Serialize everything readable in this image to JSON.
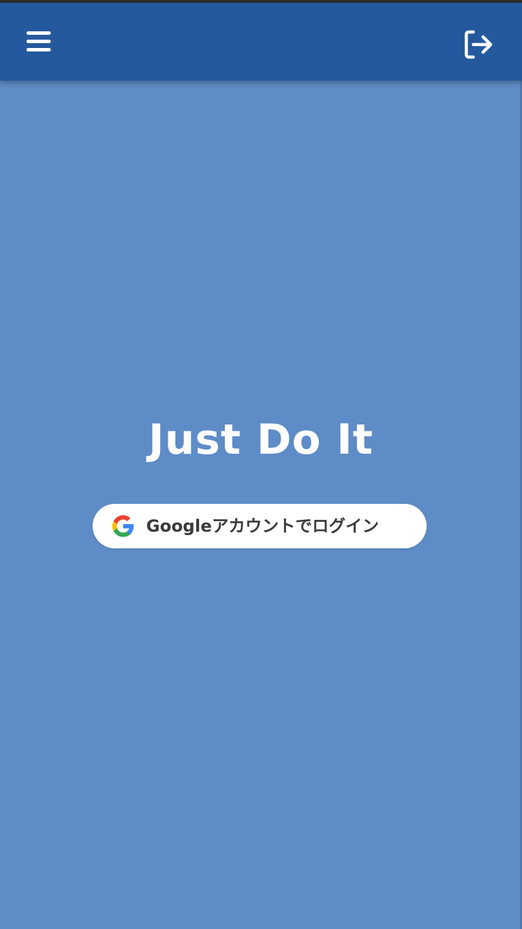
{
  "header": {
    "menu_icon": "hamburger-menu-icon",
    "logout_icon": "logout-icon"
  },
  "main": {
    "title": "Just Do It",
    "login_button": {
      "label": "Googleアカウントでログイン",
      "icon": "google-g-icon"
    }
  },
  "colors": {
    "app_bar": "#25599d",
    "background": "#5e8cc6",
    "button_background": "#ffffff",
    "button_text": "#3b3b3b",
    "title_text": "#ffffff"
  }
}
